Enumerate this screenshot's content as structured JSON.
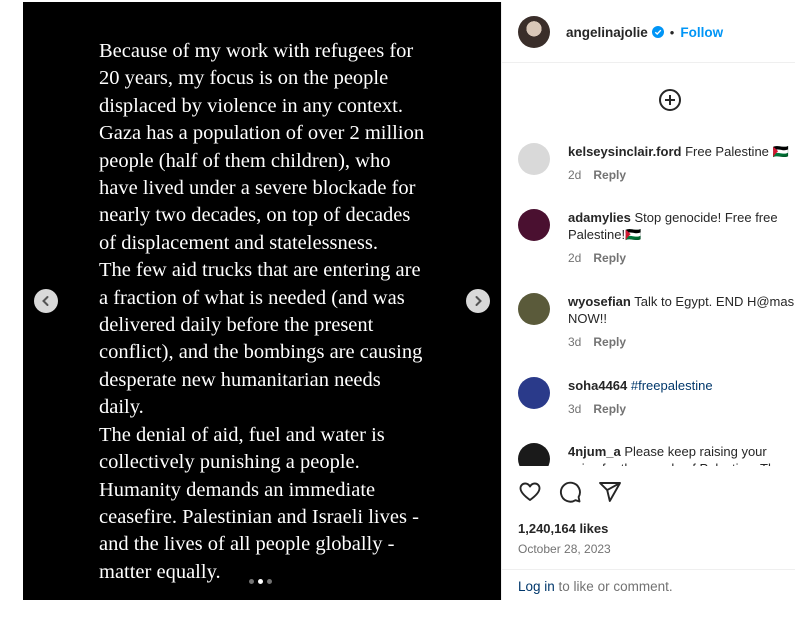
{
  "post": {
    "caption_lines": [
      "Because of my work with refugees for",
      "20 years, my focus is on the people",
      "displaced by violence in any context.",
      "Gaza has a population of over 2 million",
      "people (half of them children), who",
      "have lived under a severe blockade for",
      "nearly two decades, on top of decades",
      "of displacement and statelessness.",
      "The few aid trucks that are entering are",
      "a fraction of what is needed (and was",
      "delivered daily before the present",
      "conflict), and the bombings are causing",
      "desperate new humanitarian needs daily.",
      "The denial of aid, fuel and water is",
      "collectively punishing a people.",
      "Humanity demands an immediate",
      "ceasefire. Palestinian and Israeli lives -",
      "and the lives of all people globally -",
      "matter equally."
    ],
    "carousel": {
      "total": 3,
      "active_index": 1
    },
    "icons": {
      "prev": "chevron-left-icon",
      "next": "chevron-right-icon"
    }
  },
  "header": {
    "username": "angelinajolie",
    "separator": "•",
    "follow_label": "Follow",
    "verified_color": "#0095f6"
  },
  "comments": [
    {
      "user": "kelseysinclair.ford",
      "text": "Free Palestine 🇵🇸",
      "time": "2d",
      "reply": "Reply",
      "avatar_color": "#d9d9d9"
    },
    {
      "user": "adamylies",
      "text": "Stop genocide! Free free Palestine!🇵🇸",
      "time": "2d",
      "reply": "Reply",
      "avatar_color": "#4a1030"
    },
    {
      "user": "wyosefian",
      "text": "Talk to Egypt. END H@mas NOW!!",
      "time": "3d",
      "reply": "Reply",
      "avatar_color": "#5a5a3a"
    },
    {
      "user": "soha4464",
      "text": "#freepalestine",
      "time": "3d",
      "reply": "Reply",
      "avatar_color": "#2a3a8a"
    },
    {
      "user": "4njum_a",
      "text": "Please keep raising your voice for the people of Palestine. They are",
      "time": "",
      "reply": "",
      "avatar_color": "#1a1a1a"
    }
  ],
  "footer": {
    "likes": "1,240,164 likes",
    "date": "October 28, 2023",
    "login_link": "Log in",
    "login_rest": " to like or comment."
  },
  "colors": {
    "link": "#0095f6",
    "muted": "#737373",
    "hashtag": "#00376b"
  }
}
